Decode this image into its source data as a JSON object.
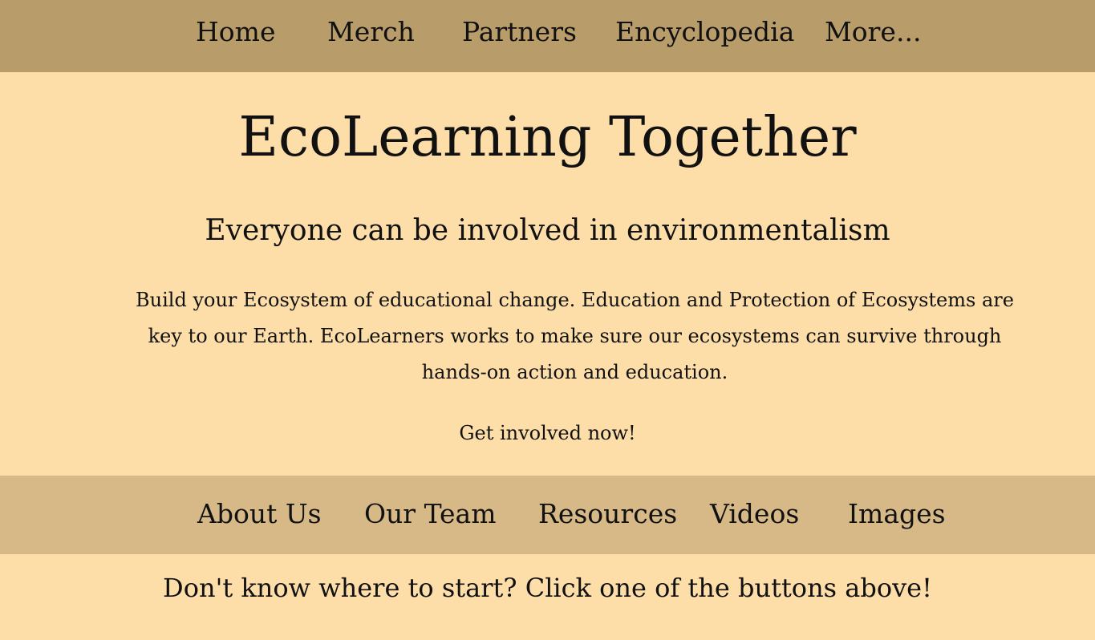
{
  "top_nav": {
    "items": [
      "Home",
      "Merch",
      "Partners",
      "Encyclopedia",
      "More..."
    ]
  },
  "hero": {
    "title": "EcoLearning Together",
    "subtitle": "Everyone can be involved in environmentalism",
    "body": "Build your Ecosystem of educational change. Education and Protection of Ecosystems are key to our Earth. EcoLearners works to make sure our ecosystems can survive through hands-on action and education.",
    "cta": "Get involved now!"
  },
  "sub_nav": {
    "items": [
      "About Us",
      "Our Team",
      "Resources",
      "Videos",
      "Images"
    ]
  },
  "footer_note": "Don't know where to start? Click one of the buttons above!",
  "colors": {
    "page_background": "#fddea9",
    "top_nav_background": "#b89c6a",
    "sub_nav_background": "#d7b987",
    "text": "#111111"
  }
}
